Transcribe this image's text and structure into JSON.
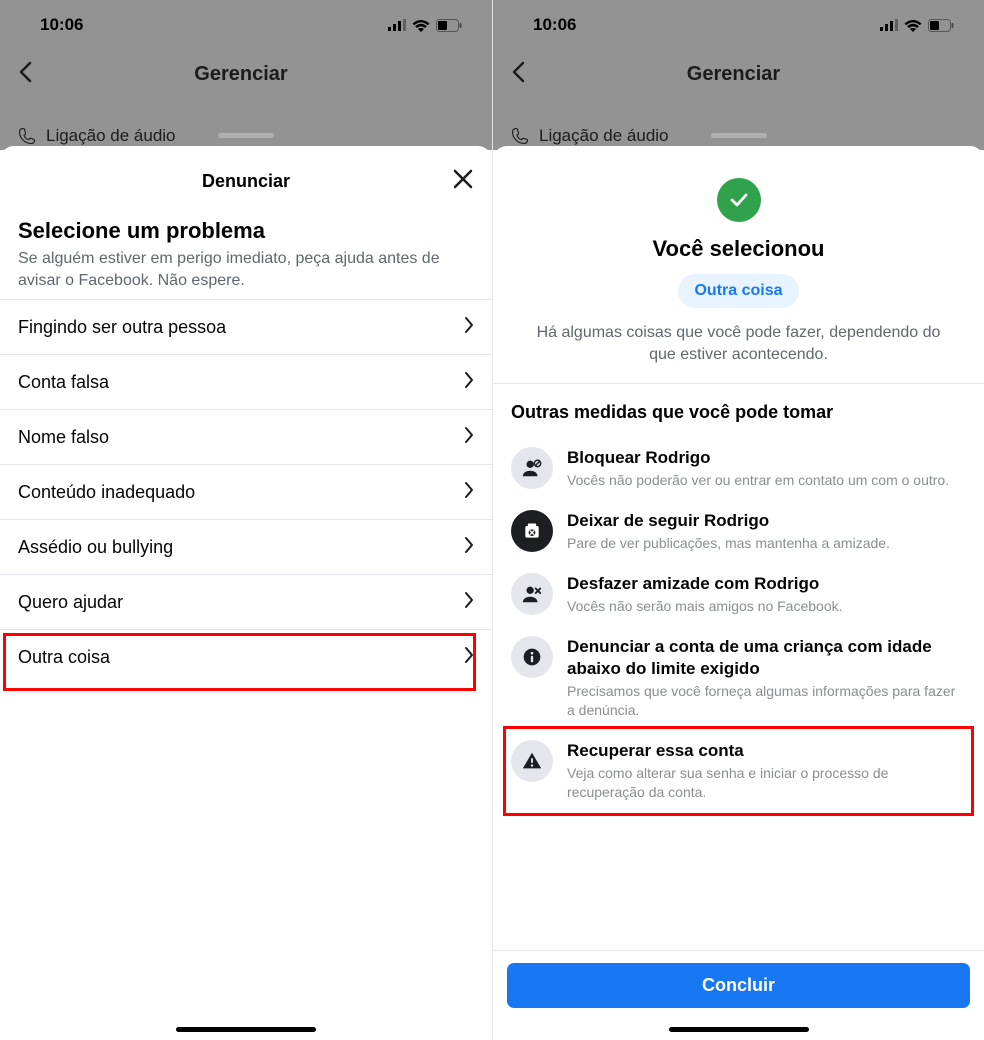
{
  "status": {
    "time": "10:06"
  },
  "dimHeader": {
    "title": "Gerenciar",
    "audioHint": "Ligação de áudio"
  },
  "left": {
    "sheetTitle": "Denunciar",
    "h1": "Selecione um problema",
    "subtext": "Se alguém estiver em perigo imediato, peça ajuda antes de avisar o Facebook. Não espere.",
    "rows": [
      "Fingindo ser outra pessoa",
      "Conta falsa",
      "Nome falso",
      "Conteúdo inadequado",
      "Assédio ou bullying",
      "Quero ajudar",
      "Outra coisa"
    ]
  },
  "right": {
    "h2": "Você selecionou",
    "chip": "Outra coisa",
    "desc": "Há algumas coisas que você pode fazer, dependendo do que estiver acontecendo.",
    "actionsTitle": "Outras medidas que você pode tomar",
    "actions": [
      {
        "title": "Bloquear Rodrigo",
        "sub": "Vocês não poderão ver ou entrar em contato um com o outro."
      },
      {
        "title": "Deixar de seguir Rodrigo",
        "sub": "Pare de ver publicações, mas mantenha a amizade."
      },
      {
        "title": "Desfazer amizade com Rodrigo",
        "sub": "Vocês não serão mais amigos no Facebook."
      },
      {
        "title": "Denunciar a conta de uma criança com idade abaixo do limite exigido",
        "sub": "Precisamos que você forneça algumas informações para fazer a denúncia."
      },
      {
        "title": "Recuperar essa conta",
        "sub": "Veja como alterar sua senha e iniciar o processo de recuperação da conta."
      }
    ],
    "button": "Concluir"
  }
}
